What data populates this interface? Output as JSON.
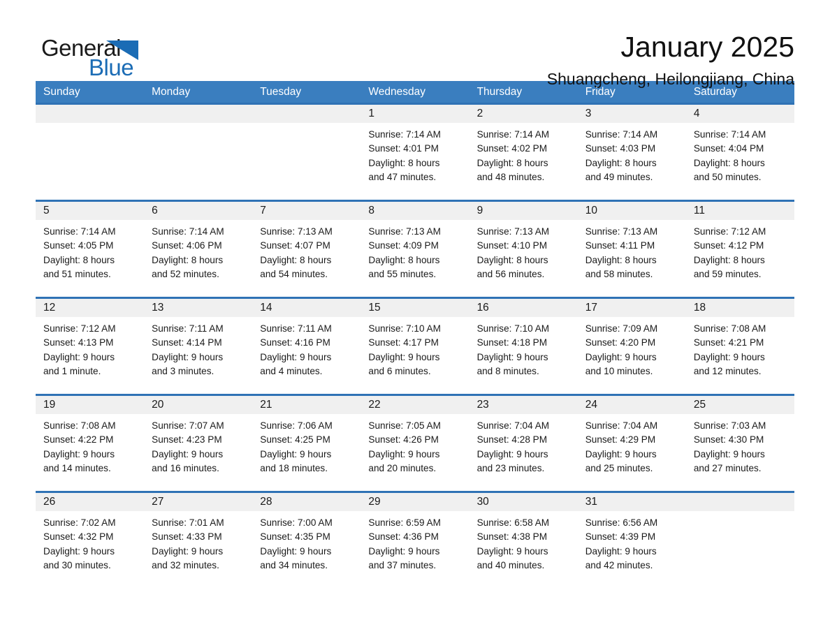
{
  "brand": {
    "word_one": "General",
    "word_two": "Blue",
    "accent_color": "#1b6cb5"
  },
  "header": {
    "title": "January 2025",
    "location": "Shuangcheng, Heilongjiang, China"
  },
  "theme": {
    "header_row_bg": "#3a7ebf",
    "week_divider": "#2f72b5",
    "daynum_band_bg": "#f0f0f0"
  },
  "weekdays": [
    "Sunday",
    "Monday",
    "Tuesday",
    "Wednesday",
    "Thursday",
    "Friday",
    "Saturday"
  ],
  "weeks": [
    [
      {
        "day": "",
        "lines": []
      },
      {
        "day": "",
        "lines": []
      },
      {
        "day": "",
        "lines": []
      },
      {
        "day": "1",
        "lines": [
          "Sunrise: 7:14 AM",
          "Sunset: 4:01 PM",
          "Daylight: 8 hours",
          "and 47 minutes."
        ]
      },
      {
        "day": "2",
        "lines": [
          "Sunrise: 7:14 AM",
          "Sunset: 4:02 PM",
          "Daylight: 8 hours",
          "and 48 minutes."
        ]
      },
      {
        "day": "3",
        "lines": [
          "Sunrise: 7:14 AM",
          "Sunset: 4:03 PM",
          "Daylight: 8 hours",
          "and 49 minutes."
        ]
      },
      {
        "day": "4",
        "lines": [
          "Sunrise: 7:14 AM",
          "Sunset: 4:04 PM",
          "Daylight: 8 hours",
          "and 50 minutes."
        ]
      }
    ],
    [
      {
        "day": "5",
        "lines": [
          "Sunrise: 7:14 AM",
          "Sunset: 4:05 PM",
          "Daylight: 8 hours",
          "and 51 minutes."
        ]
      },
      {
        "day": "6",
        "lines": [
          "Sunrise: 7:14 AM",
          "Sunset: 4:06 PM",
          "Daylight: 8 hours",
          "and 52 minutes."
        ]
      },
      {
        "day": "7",
        "lines": [
          "Sunrise: 7:13 AM",
          "Sunset: 4:07 PM",
          "Daylight: 8 hours",
          "and 54 minutes."
        ]
      },
      {
        "day": "8",
        "lines": [
          "Sunrise: 7:13 AM",
          "Sunset: 4:09 PM",
          "Daylight: 8 hours",
          "and 55 minutes."
        ]
      },
      {
        "day": "9",
        "lines": [
          "Sunrise: 7:13 AM",
          "Sunset: 4:10 PM",
          "Daylight: 8 hours",
          "and 56 minutes."
        ]
      },
      {
        "day": "10",
        "lines": [
          "Sunrise: 7:13 AM",
          "Sunset: 4:11 PM",
          "Daylight: 8 hours",
          "and 58 minutes."
        ]
      },
      {
        "day": "11",
        "lines": [
          "Sunrise: 7:12 AM",
          "Sunset: 4:12 PM",
          "Daylight: 8 hours",
          "and 59 minutes."
        ]
      }
    ],
    [
      {
        "day": "12",
        "lines": [
          "Sunrise: 7:12 AM",
          "Sunset: 4:13 PM",
          "Daylight: 9 hours",
          "and 1 minute."
        ]
      },
      {
        "day": "13",
        "lines": [
          "Sunrise: 7:11 AM",
          "Sunset: 4:14 PM",
          "Daylight: 9 hours",
          "and 3 minutes."
        ]
      },
      {
        "day": "14",
        "lines": [
          "Sunrise: 7:11 AM",
          "Sunset: 4:16 PM",
          "Daylight: 9 hours",
          "and 4 minutes."
        ]
      },
      {
        "day": "15",
        "lines": [
          "Sunrise: 7:10 AM",
          "Sunset: 4:17 PM",
          "Daylight: 9 hours",
          "and 6 minutes."
        ]
      },
      {
        "day": "16",
        "lines": [
          "Sunrise: 7:10 AM",
          "Sunset: 4:18 PM",
          "Daylight: 9 hours",
          "and 8 minutes."
        ]
      },
      {
        "day": "17",
        "lines": [
          "Sunrise: 7:09 AM",
          "Sunset: 4:20 PM",
          "Daylight: 9 hours",
          "and 10 minutes."
        ]
      },
      {
        "day": "18",
        "lines": [
          "Sunrise: 7:08 AM",
          "Sunset: 4:21 PM",
          "Daylight: 9 hours",
          "and 12 minutes."
        ]
      }
    ],
    [
      {
        "day": "19",
        "lines": [
          "Sunrise: 7:08 AM",
          "Sunset: 4:22 PM",
          "Daylight: 9 hours",
          "and 14 minutes."
        ]
      },
      {
        "day": "20",
        "lines": [
          "Sunrise: 7:07 AM",
          "Sunset: 4:23 PM",
          "Daylight: 9 hours",
          "and 16 minutes."
        ]
      },
      {
        "day": "21",
        "lines": [
          "Sunrise: 7:06 AM",
          "Sunset: 4:25 PM",
          "Daylight: 9 hours",
          "and 18 minutes."
        ]
      },
      {
        "day": "22",
        "lines": [
          "Sunrise: 7:05 AM",
          "Sunset: 4:26 PM",
          "Daylight: 9 hours",
          "and 20 minutes."
        ]
      },
      {
        "day": "23",
        "lines": [
          "Sunrise: 7:04 AM",
          "Sunset: 4:28 PM",
          "Daylight: 9 hours",
          "and 23 minutes."
        ]
      },
      {
        "day": "24",
        "lines": [
          "Sunrise: 7:04 AM",
          "Sunset: 4:29 PM",
          "Daylight: 9 hours",
          "and 25 minutes."
        ]
      },
      {
        "day": "25",
        "lines": [
          "Sunrise: 7:03 AM",
          "Sunset: 4:30 PM",
          "Daylight: 9 hours",
          "and 27 minutes."
        ]
      }
    ],
    [
      {
        "day": "26",
        "lines": [
          "Sunrise: 7:02 AM",
          "Sunset: 4:32 PM",
          "Daylight: 9 hours",
          "and 30 minutes."
        ]
      },
      {
        "day": "27",
        "lines": [
          "Sunrise: 7:01 AM",
          "Sunset: 4:33 PM",
          "Daylight: 9 hours",
          "and 32 minutes."
        ]
      },
      {
        "day": "28",
        "lines": [
          "Sunrise: 7:00 AM",
          "Sunset: 4:35 PM",
          "Daylight: 9 hours",
          "and 34 minutes."
        ]
      },
      {
        "day": "29",
        "lines": [
          "Sunrise: 6:59 AM",
          "Sunset: 4:36 PM",
          "Daylight: 9 hours",
          "and 37 minutes."
        ]
      },
      {
        "day": "30",
        "lines": [
          "Sunrise: 6:58 AM",
          "Sunset: 4:38 PM",
          "Daylight: 9 hours",
          "and 40 minutes."
        ]
      },
      {
        "day": "31",
        "lines": [
          "Sunrise: 6:56 AM",
          "Sunset: 4:39 PM",
          "Daylight: 9 hours",
          "and 42 minutes."
        ]
      },
      {
        "day": "",
        "lines": []
      }
    ]
  ]
}
